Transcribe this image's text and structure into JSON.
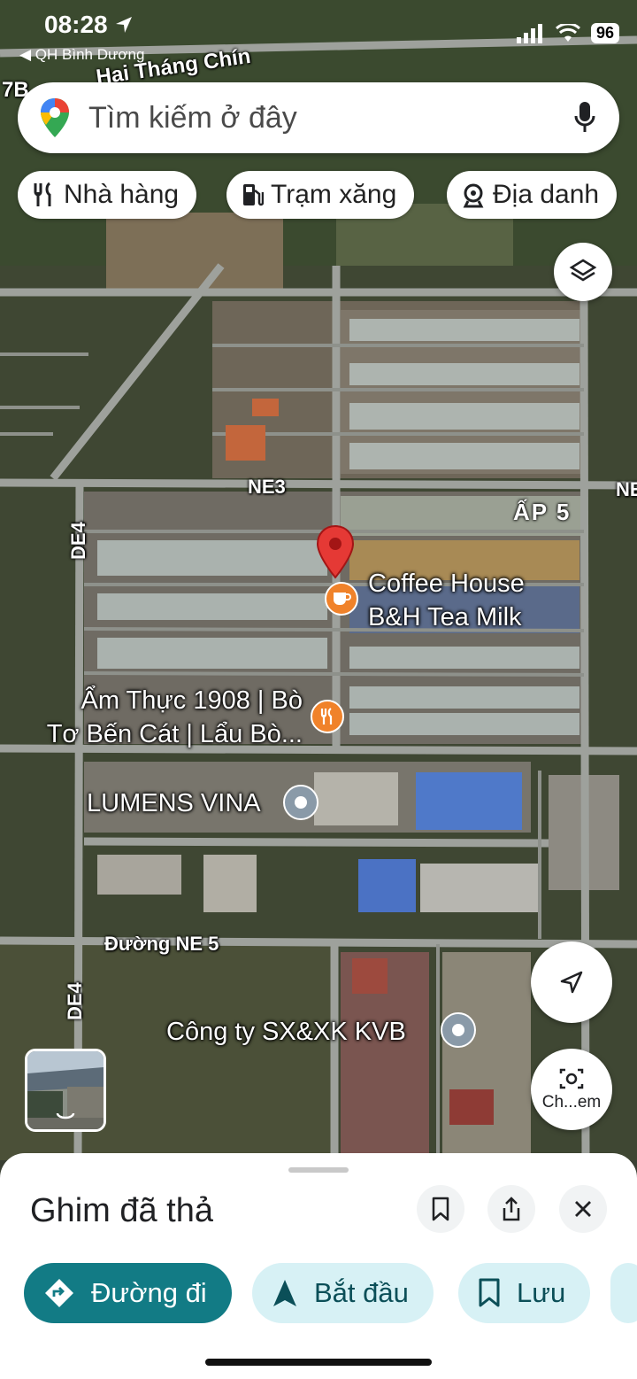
{
  "status_bar": {
    "time": "08:28",
    "back_app": "◀ QH Bình Dương",
    "battery": "96"
  },
  "search": {
    "placeholder": "Tìm kiếm ở đây"
  },
  "chips": [
    {
      "label": "Nhà hàng",
      "icon": "fork-knife-icon"
    },
    {
      "label": "Trạm xăng",
      "icon": "gas-pump-icon"
    },
    {
      "label": "Địa danh",
      "icon": "landmark-icon"
    }
  ],
  "map": {
    "road_labels": {
      "top_road": "Hai Tháng Chín",
      "top_left": "7B",
      "ne3": "NE3",
      "ne_edge": "NE",
      "de4_upper": "DE4",
      "de4_lower": "DE4",
      "ne5": "Đường NE 5"
    },
    "area_label": "ẤP 5",
    "places": {
      "coffee": [
        "Coffee House",
        "B&H Tea Milk"
      ],
      "am_thuc": [
        "Ẩm Thực 1908 | Bò",
        "Tơ Bến Cát | Lẩu Bò..."
      ],
      "lumens": "LUMENS VINA",
      "cong_ty": "Công ty SX&XK KVB"
    },
    "colors": {
      "pin": "#e53935",
      "poi_food": "#f0822a",
      "poi_generic": "#8a9aa8"
    }
  },
  "controls": {
    "street_view_label": "Ch...em"
  },
  "sheet": {
    "title": "Ghim đã thả",
    "actions": [
      {
        "label": "Đường đi",
        "icon": "directions-icon"
      },
      {
        "label": "Bắt đầu",
        "icon": "navigation-arrow-icon"
      },
      {
        "label": "Lưu",
        "icon": "bookmark-icon"
      }
    ]
  }
}
